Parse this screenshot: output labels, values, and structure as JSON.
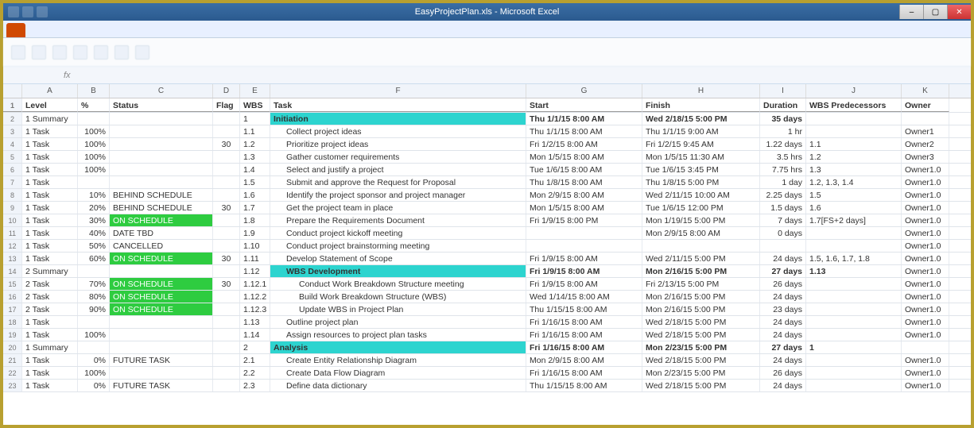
{
  "window": {
    "title": "EasyProjectPlan.xls - Microsoft Excel"
  },
  "formula_bar": {
    "name_box": "",
    "fx_label": "fx"
  },
  "headers": {
    "level": "Level",
    "pct": "%",
    "status": "Status",
    "flag": "Flag",
    "wbs": "WBS",
    "task": "Task",
    "start": "Start",
    "finish": "Finish",
    "duration": "Duration",
    "predecessors": "WBS Predecessors",
    "owner": "Owner"
  },
  "col_letters": [
    "",
    "A",
    "B",
    "C",
    "D",
    "E",
    "F",
    "G",
    "H",
    "I",
    "J",
    "K"
  ],
  "rows": [
    {
      "n": 2,
      "level": "1 Summary",
      "pct": "",
      "status": "",
      "flag": "",
      "wbs": "1",
      "task": "Initiation",
      "start": "Thu 1/1/15 8:00 AM",
      "finish": "Wed 2/18/15 5:00 PM",
      "dur": "35 days",
      "pred": "",
      "owner": "",
      "summary": true,
      "indent": 0
    },
    {
      "n": 3,
      "level": "1 Task",
      "pct": "100%",
      "status": "",
      "flag": "",
      "wbs": "1.1",
      "task": "Collect project ideas",
      "start": "Thu 1/1/15 8:00 AM",
      "finish": "Thu 1/1/15 9:00 AM",
      "dur": "1 hr",
      "pred": "",
      "owner": "Owner1",
      "indent": 1
    },
    {
      "n": 4,
      "level": "1 Task",
      "pct": "100%",
      "status": "",
      "flag": "30",
      "wbs": "1.2",
      "task": "Prioritize project ideas",
      "start": "Fri 1/2/15 8:00 AM",
      "finish": "Fri 1/2/15 9:45 AM",
      "dur": "1.22 days",
      "pred": "1.1",
      "owner": "Owner2",
      "indent": 1
    },
    {
      "n": 5,
      "level": "1 Task",
      "pct": "100%",
      "status": "",
      "flag": "",
      "wbs": "1.3",
      "task": "Gather customer requirements",
      "start": "Mon 1/5/15 8:00 AM",
      "finish": "Mon 1/5/15 11:30 AM",
      "dur": "3.5 hrs",
      "pred": "1.2",
      "owner": "Owner3",
      "indent": 1
    },
    {
      "n": 6,
      "level": "1 Task",
      "pct": "100%",
      "status": "",
      "flag": "",
      "wbs": "1.4",
      "task": "Select and justify a project",
      "start": "Tue 1/6/15 8:00 AM",
      "finish": "Tue 1/6/15 3:45 PM",
      "dur": "7.75 hrs",
      "pred": "1.3",
      "owner": "Owner1.0",
      "indent": 1
    },
    {
      "n": 7,
      "level": "1 Task",
      "pct": "",
      "status": "",
      "flag": "",
      "wbs": "1.5",
      "task": "Submit and approve the Request for Proposal",
      "start": "Thu 1/8/15 8:00 AM",
      "finish": "Thu 1/8/15 5:00 PM",
      "dur": "1 day",
      "pred": "1.2, 1.3, 1.4",
      "owner": "Owner1.0",
      "indent": 1
    },
    {
      "n": 8,
      "level": "1 Task",
      "pct": "10%",
      "status": "BEHIND SCHEDULE",
      "flag": "",
      "wbs": "1.6",
      "task": "Identify the project sponsor and project manager",
      "start": "Mon 2/9/15 8:00 AM",
      "finish": "Wed 2/11/15 10:00 AM",
      "dur": "2.25 days",
      "pred": "1.5",
      "owner": "Owner1.0",
      "indent": 1,
      "st": "behind"
    },
    {
      "n": 9,
      "level": "1 Task",
      "pct": "20%",
      "status": "BEHIND SCHEDULE",
      "flag": "30",
      "wbs": "1.7",
      "task": "Get the project team in place",
      "start": "Mon 1/5/15 8:00 AM",
      "finish": "Tue 1/6/15 12:00 PM",
      "dur": "1.5 days",
      "pred": "1.6",
      "owner": "Owner1.0",
      "indent": 1,
      "st": "behind"
    },
    {
      "n": 10,
      "level": "1 Task",
      "pct": "30%",
      "status": "ON SCHEDULE",
      "flag": "",
      "wbs": "1.8",
      "task": "Prepare the Requirements Document",
      "start": "Fri 1/9/15 8:00 PM",
      "finish": "Mon 1/19/15 5:00 PM",
      "dur": "7 days",
      "pred": "1.7[FS+2 days]",
      "owner": "Owner1.0",
      "indent": 1,
      "st": "green"
    },
    {
      "n": 11,
      "level": "1 Task",
      "pct": "40%",
      "status": "DATE TBD",
      "flag": "",
      "wbs": "1.9",
      "task": "Conduct project kickoff meeting",
      "start": "",
      "finish": "Mon 2/9/15 8:00 AM",
      "dur": "0 days",
      "pred": "",
      "owner": "Owner1.0",
      "indent": 1
    },
    {
      "n": 12,
      "level": "1 Task",
      "pct": "50%",
      "status": "CANCELLED",
      "flag": "",
      "wbs": "1.10",
      "task": "Conduct project brainstorming meeting",
      "start": "",
      "finish": "",
      "dur": "",
      "pred": "",
      "owner": "Owner1.0",
      "indent": 1
    },
    {
      "n": 13,
      "level": "1 Task",
      "pct": "60%",
      "status": "ON SCHEDULE",
      "flag": "30",
      "wbs": "1.11",
      "task": "Develop Statement of Scope",
      "start": "Fri 1/9/15 8:00 AM",
      "finish": "Wed 2/11/15 5:00 PM",
      "dur": "24 days",
      "pred": "1.5, 1.6, 1.7, 1.8",
      "owner": "Owner1.0",
      "indent": 1,
      "st": "green"
    },
    {
      "n": 14,
      "level": "2 Summary",
      "pct": "",
      "status": "",
      "flag": "",
      "wbs": "1.12",
      "task": "WBS Development",
      "start": "Fri 1/9/15 8:00 AM",
      "finish": "Mon 2/16/15 5:00 PM",
      "dur": "27 days",
      "pred": "1.13",
      "owner": "Owner1.0",
      "summary": true,
      "indent": 1
    },
    {
      "n": 15,
      "level": "2 Task",
      "pct": "70%",
      "status": "ON SCHEDULE",
      "flag": "30",
      "wbs": "1.12.1",
      "task": "Conduct Work Breakdown Structure meeting",
      "start": "Fri 1/9/15 8:00 AM",
      "finish": "Fri 2/13/15 5:00 PM",
      "dur": "26 days",
      "pred": "",
      "owner": "Owner1.0",
      "indent": 2,
      "st": "green"
    },
    {
      "n": 16,
      "level": "2 Task",
      "pct": "80%",
      "status": "ON SCHEDULE",
      "flag": "",
      "wbs": "1.12.2",
      "task": "Build Work Breakdown Structure (WBS)",
      "start": "Wed 1/14/15 8:00 AM",
      "finish": "Mon 2/16/15 5:00 PM",
      "dur": "24 days",
      "pred": "",
      "owner": "Owner1.0",
      "indent": 2,
      "st": "green"
    },
    {
      "n": 17,
      "level": "2 Task",
      "pct": "90%",
      "status": "ON SCHEDULE",
      "flag": "",
      "wbs": "1.12.3",
      "task": "Update WBS in Project Plan",
      "start": "Thu 1/15/15 8:00 AM",
      "finish": "Mon 2/16/15 5:00 PM",
      "dur": "23 days",
      "pred": "",
      "owner": "Owner1.0",
      "indent": 2,
      "st": "green"
    },
    {
      "n": 18,
      "level": "1 Task",
      "pct": "",
      "status": "",
      "flag": "",
      "wbs": "1.13",
      "task": "Outline project plan",
      "start": "Fri 1/16/15 8:00 AM",
      "finish": "Wed 2/18/15 5:00 PM",
      "dur": "24 days",
      "pred": "",
      "owner": "Owner1.0",
      "indent": 1
    },
    {
      "n": 19,
      "level": "1 Task",
      "pct": "100%",
      "status": "",
      "flag": "",
      "wbs": "1.14",
      "task": "Assign resources to project plan tasks",
      "start": "Fri 1/16/15 8:00 AM",
      "finish": "Wed 2/18/15 5:00 PM",
      "dur": "24 days",
      "pred": "",
      "owner": "Owner1.0",
      "indent": 1
    },
    {
      "n": 20,
      "level": "1 Summary",
      "pct": "",
      "status": "",
      "flag": "",
      "wbs": "2",
      "task": "Analysis",
      "start": "Fri 1/16/15 8:00 AM",
      "finish": "Mon 2/23/15 5:00 PM",
      "dur": "27 days",
      "pred": "1",
      "owner": "",
      "summary": true,
      "indent": 0
    },
    {
      "n": 21,
      "level": "1 Task",
      "pct": "0%",
      "status": "FUTURE TASK",
      "flag": "",
      "wbs": "2.1",
      "task": "Create Entity Relationship Diagram",
      "start": "Mon 2/9/15 8:00 AM",
      "finish": "Wed 2/18/15 5:00 PM",
      "dur": "24 days",
      "pred": "",
      "owner": "Owner1.0",
      "indent": 1
    },
    {
      "n": 22,
      "level": "1 Task",
      "pct": "100%",
      "status": "",
      "flag": "",
      "wbs": "2.2",
      "task": "Create Data Flow Diagram",
      "start": "Fri 1/16/15 8:00 AM",
      "finish": "Mon 2/23/15 5:00 PM",
      "dur": "26 days",
      "pred": "",
      "owner": "Owner1.0",
      "indent": 1
    },
    {
      "n": 23,
      "level": "1 Task",
      "pct": "0%",
      "status": "FUTURE TASK",
      "flag": "",
      "wbs": "2.3",
      "task": "Define data dictionary",
      "start": "Thu 1/15/15 8:00 AM",
      "finish": "Wed 2/18/15 5:00 PM",
      "dur": "24 days",
      "pred": "",
      "owner": "Owner1.0",
      "indent": 1
    }
  ]
}
